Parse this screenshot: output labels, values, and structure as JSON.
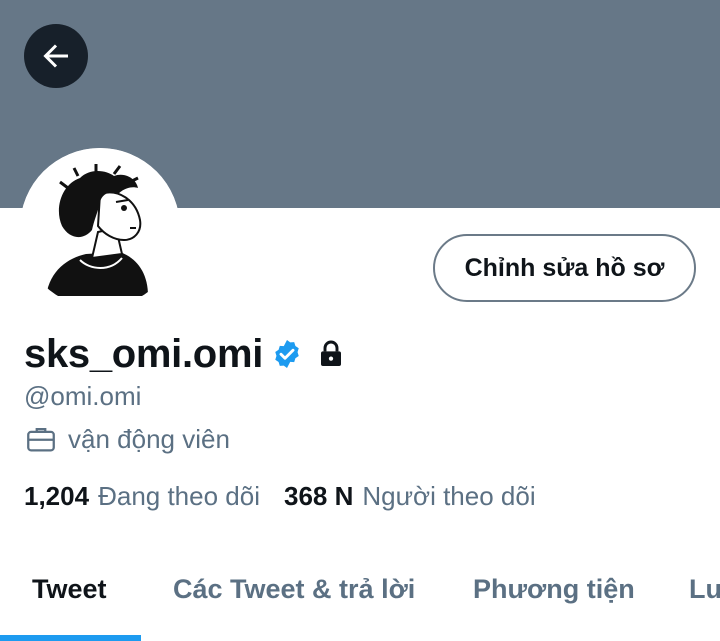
{
  "profile": {
    "display_name": "sks_omi.omi",
    "handle": "@omi.omi",
    "job": "vận động viên",
    "edit_button_label": "Chỉnh sửa hồ sơ",
    "verified": true,
    "protected": true
  },
  "stats": {
    "following_count": "1,204",
    "following_label": "Đang theo dõi",
    "followers_count": "368 N",
    "followers_label": "Người theo dõi"
  },
  "tabs": [
    {
      "label": "Tweet",
      "active": true
    },
    {
      "label": "Các Tweet & trả lời",
      "active": false
    },
    {
      "label": "Phương tiện",
      "active": false
    },
    {
      "label": "Lu",
      "active": false
    }
  ],
  "icons": {
    "back": "arrow-left-icon",
    "verified": "verified-badge-icon",
    "lock": "lock-icon",
    "job": "briefcase-icon"
  },
  "colors": {
    "banner": "#667787",
    "accent": "#1d9bf0",
    "secondary_text": "#5b7083",
    "primary_text": "#0f1419"
  }
}
